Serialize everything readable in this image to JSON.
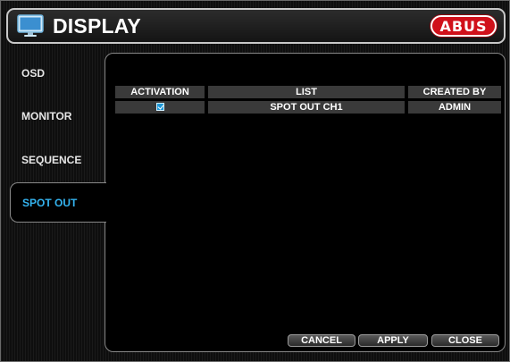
{
  "header": {
    "title": "DISPLAY",
    "icon": "monitor-icon",
    "logo_text": "ABUS",
    "logo_color": "#d0101a"
  },
  "tabs": [
    {
      "label": "OSD",
      "active": false
    },
    {
      "label": "MONITOR",
      "active": false
    },
    {
      "label": "SEQUENCE",
      "active": false
    },
    {
      "label": "SPOT OUT",
      "active": true
    }
  ],
  "table": {
    "columns": [
      "ACTIVATION",
      "LIST",
      "CREATED BY"
    ],
    "rows": [
      {
        "activation_checked": true,
        "list": "SPOT OUT CH1",
        "created_by": "ADMIN"
      }
    ]
  },
  "buttons": {
    "cancel": "CANCEL",
    "apply": "APPLY",
    "close": "CLOSE"
  },
  "colors": {
    "active_tab": "#34b4f0",
    "checkbox": "#1e98d8"
  }
}
